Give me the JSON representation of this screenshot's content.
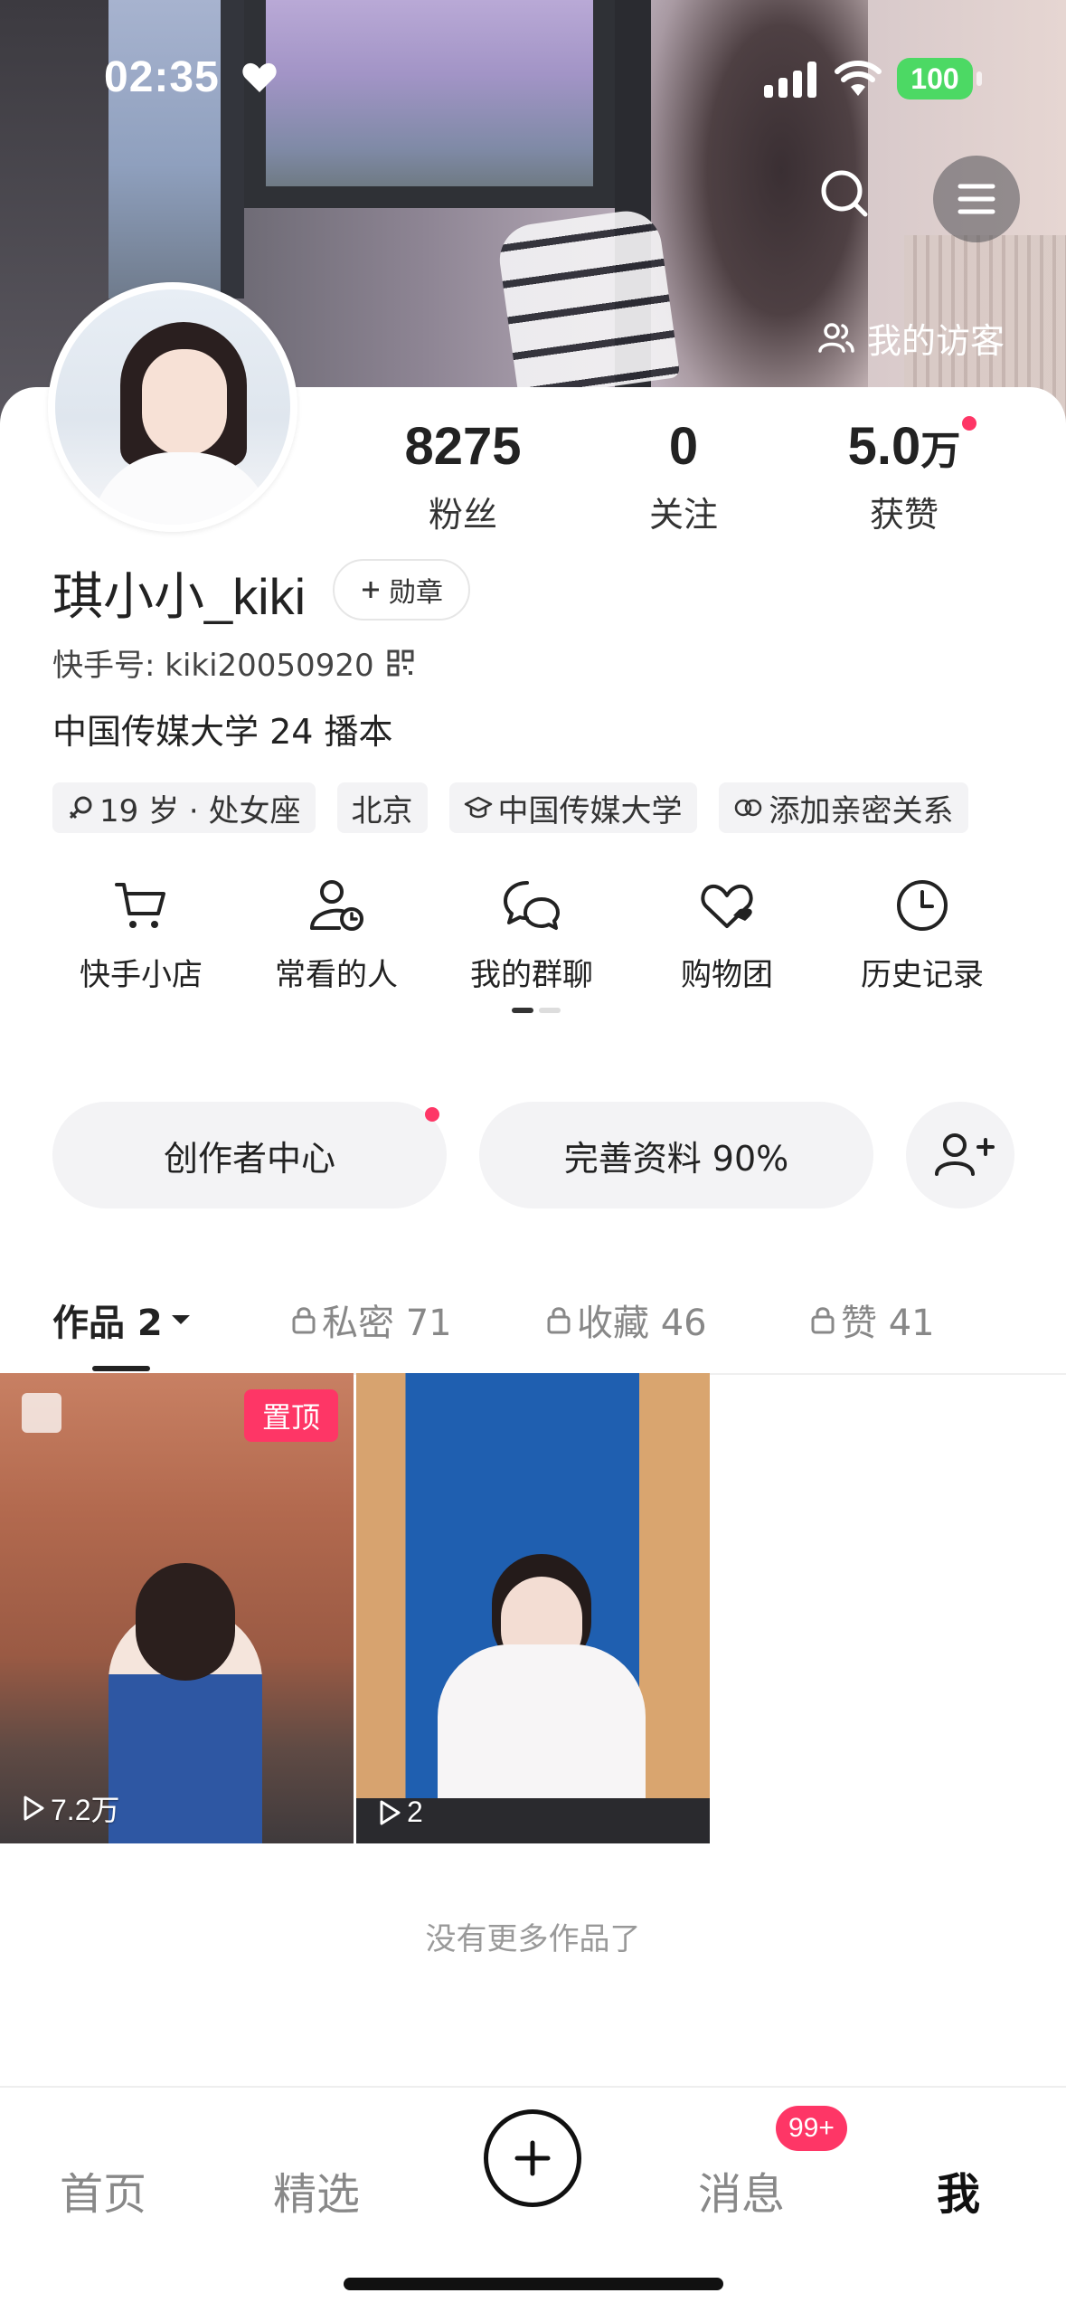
{
  "status_bar": {
    "time": "02:35",
    "battery": "100"
  },
  "header": {
    "visitors_label": "我的访客"
  },
  "profile": {
    "username": "琪小小_kiki",
    "badge_label": "勋章",
    "kuaishou_id": "快手号: kiki20050920",
    "bio": "中国传媒大学 24 播本",
    "tags": [
      "19 岁 · 处女座",
      "北京",
      "中国传媒大学",
      "添加亲密关系"
    ]
  },
  "stats": [
    {
      "value": "8275",
      "label": "粉丝"
    },
    {
      "value": "0",
      "label": "关注"
    },
    {
      "value": "5.0",
      "unit": "万",
      "label": "获赞"
    }
  ],
  "shortcuts": [
    "快手小店",
    "常看的人",
    "我的群聊",
    "购物团",
    "历史记录"
  ],
  "actions": {
    "creator_center": "创作者中心",
    "complete_profile": "完善资料 90%"
  },
  "tabs": [
    {
      "label": "作品 2",
      "locked": false
    },
    {
      "label": "私密 71",
      "locked": true
    },
    {
      "label": "收藏 46",
      "locked": true
    },
    {
      "label": "赞 41",
      "locked": true
    }
  ],
  "works": [
    {
      "plays": "7.2万",
      "pinned_label": "置顶"
    },
    {
      "plays": "2"
    }
  ],
  "footer_note": "没有更多作品了",
  "bottom_nav": {
    "home": "首页",
    "featured": "精选",
    "messages": "消息",
    "messages_badge": "99+",
    "me": "我"
  },
  "colors": {
    "accent": "#fe3666",
    "battery": "#4cd964"
  },
  "icons": [
    "heart-icon",
    "signal-icon",
    "wifi-icon",
    "search-icon",
    "menu-icon",
    "visitors-icon",
    "add-icon",
    "qr-code-icon",
    "cart-icon",
    "user-clock-icon",
    "chat-bubbles-icon",
    "heart-group-icon",
    "clock-icon",
    "lock-icon",
    "play-icon",
    "image-icon",
    "add-friend-icon",
    "plus-icon"
  ]
}
